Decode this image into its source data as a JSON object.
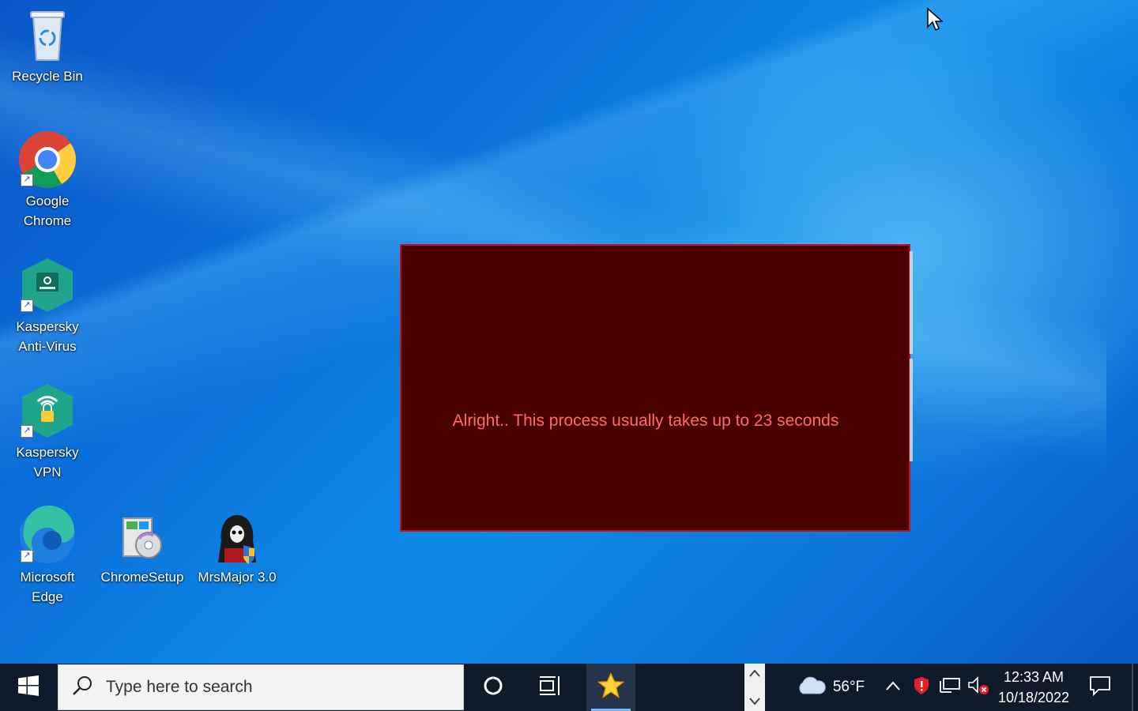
{
  "desktop": {
    "icons": [
      {
        "label": "Recycle Bin",
        "icon": "recycle-bin-icon"
      },
      {
        "label": "Google Chrome",
        "icon": "chrome-icon"
      },
      {
        "label": "Kaspersky Anti-Virus",
        "icon": "kaspersky-antivirus-icon"
      },
      {
        "label": "Kaspersky VPN",
        "icon": "kaspersky-vpn-icon"
      },
      {
        "label": "Microsoft Edge",
        "icon": "edge-icon"
      },
      {
        "label": "ChromeSetup",
        "icon": "installer-icon"
      },
      {
        "label": "MrsMajor 3.0",
        "icon": "mrsmajor-icon"
      }
    ]
  },
  "popup": {
    "message": "Alright.. This process usually takes up to 23 seconds",
    "background": "#4a0000",
    "text_color": "#ff6b6b",
    "border_color": "#c0102a"
  },
  "taskbar": {
    "start_icon": "windows-logo-icon",
    "search_placeholder": "Type here to search",
    "cortana_icon": "cortana-circle-icon",
    "task_view_icon": "task-view-icon",
    "pinned_app_icon": "star-app-icon",
    "weather_icon": "cloud-icon",
    "weather_temp": "56°F",
    "tray_icons": [
      "chevron-up-icon",
      "security-shield-icon",
      "network-icon",
      "volume-muted-icon"
    ],
    "time": "12:33 AM",
    "date": "10/18/2022",
    "notification_icon": "action-center-icon"
  }
}
